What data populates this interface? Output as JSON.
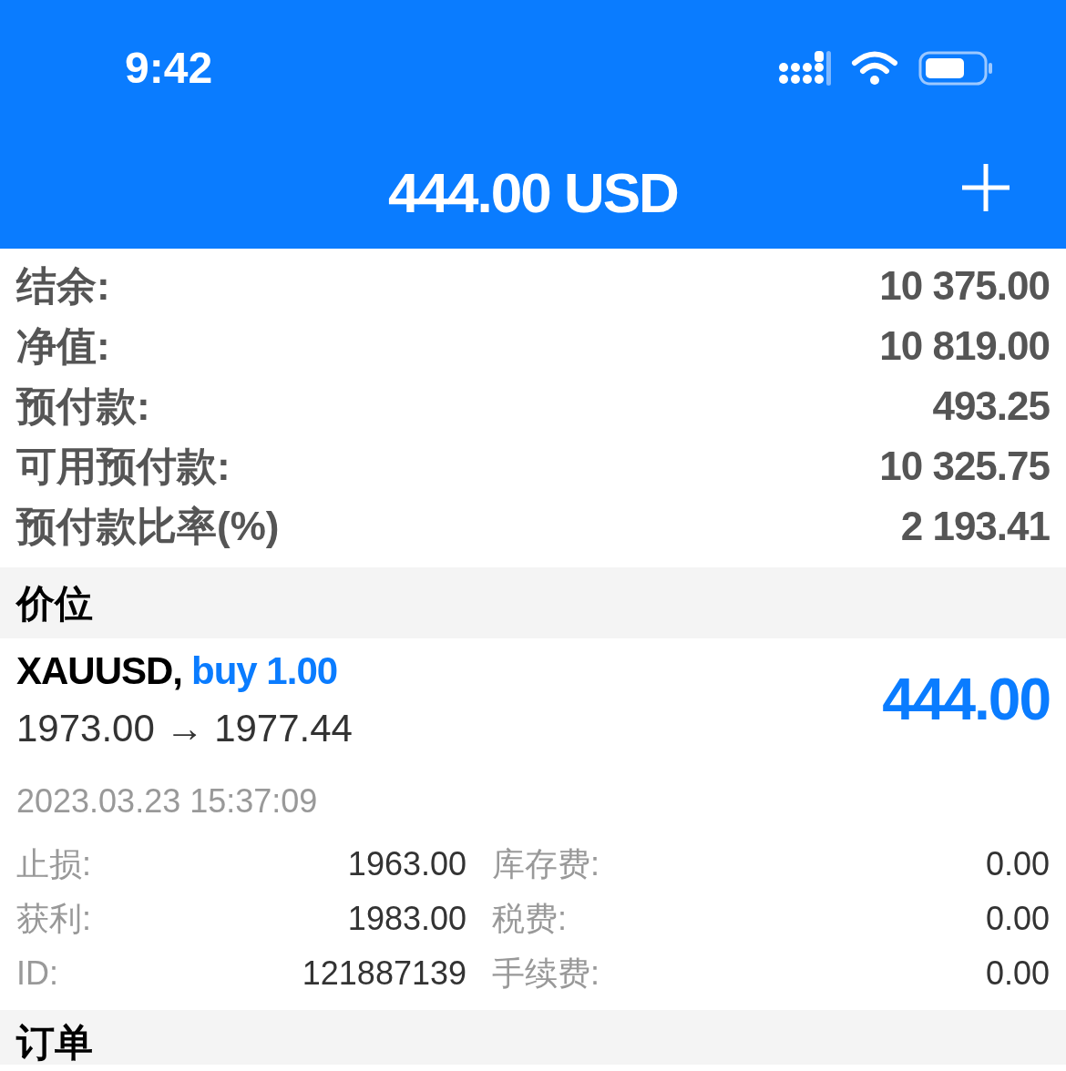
{
  "status_bar": {
    "time": "9:42"
  },
  "header": {
    "title": "444.00 USD"
  },
  "account": [
    {
      "label": "结余:",
      "value": "10 375.00"
    },
    {
      "label": "净值:",
      "value": "10 819.00"
    },
    {
      "label": "预付款:",
      "value": "493.25"
    },
    {
      "label": "可用预付款:",
      "value": "10 325.75"
    },
    {
      "label": "预付款比率(%)",
      "value": "2 193.41"
    }
  ],
  "positions": {
    "title": "价位",
    "items": [
      {
        "symbol": "XAUUSD,",
        "side": "buy 1.00",
        "prices": "1973.00 → 1977.44",
        "profit": "444.00",
        "time": "2023.03.23 15:37:09",
        "details": [
          {
            "label": "止损:",
            "value": "1963.00"
          },
          {
            "label": "库存费:",
            "value": "0.00"
          },
          {
            "label": "获利:",
            "value": "1983.00"
          },
          {
            "label": "税费:",
            "value": "0.00"
          },
          {
            "label": "ID:",
            "value": "121887139"
          },
          {
            "label": "手续费:",
            "value": "0.00"
          }
        ]
      }
    ]
  },
  "orders": {
    "title": "订单"
  }
}
